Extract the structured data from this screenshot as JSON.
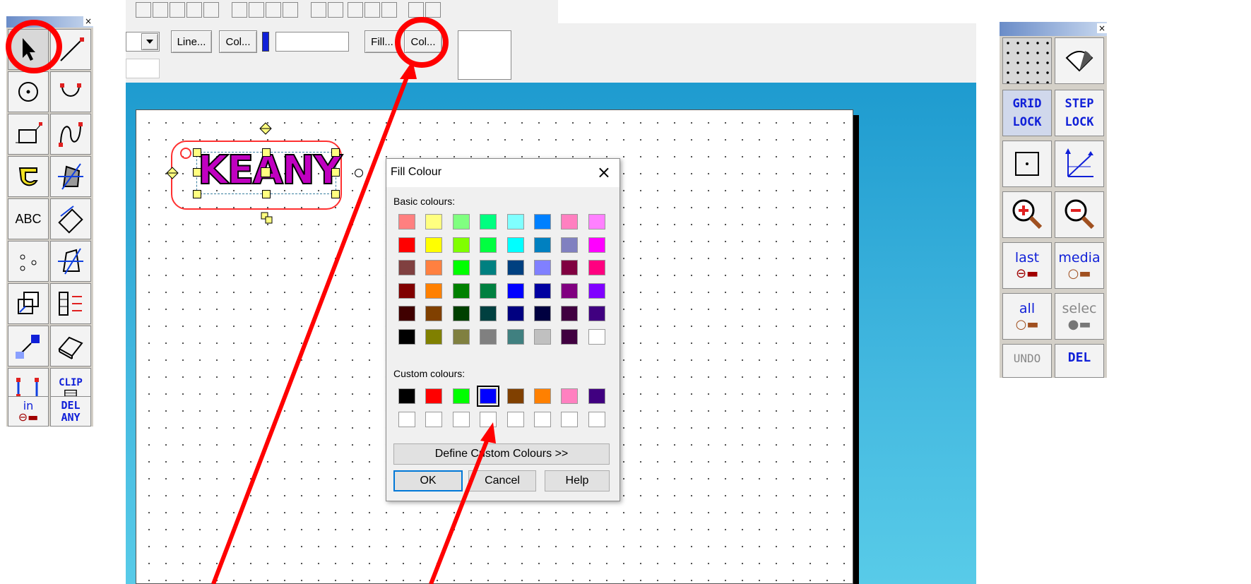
{
  "toolbar": {
    "line_button": "Line...",
    "col_button_1": "Col...",
    "line_colour": "#1020d8",
    "fill_button": "Fill...",
    "col_button_2": "Col..."
  },
  "canvas": {
    "text_object": "KEANY"
  },
  "left_tools": {
    "abc": "ABC",
    "clip": "CLIP",
    "in": "in",
    "del": "DEL",
    "any": "ANY"
  },
  "right_tools": {
    "grid": "GRID",
    "grid_lock": "LOCK",
    "step": "STEP",
    "step_lock": "LOCK",
    "last": "last",
    "media": "media",
    "all": "all",
    "selec": "selec",
    "undo": "UNDO",
    "del": "DEL"
  },
  "dialog": {
    "title": "Fill Colour",
    "basic_label": "Basic colours:",
    "custom_label": "Custom colours:",
    "define_button": "Define Custom Colours >>",
    "ok": "OK",
    "cancel": "Cancel",
    "help": "Help",
    "basic_colours": [
      "#ff8080",
      "#ffff80",
      "#80ff80",
      "#00ff80",
      "#80ffff",
      "#0080ff",
      "#ff80c0",
      "#ff80ff",
      "#ff0000",
      "#ffff00",
      "#80ff00",
      "#00ff40",
      "#00ffff",
      "#0080c0",
      "#8080c0",
      "#ff00ff",
      "#804040",
      "#ff8040",
      "#00ff00",
      "#008080",
      "#004080",
      "#8080ff",
      "#800040",
      "#ff0080",
      "#800000",
      "#ff8000",
      "#008000",
      "#008040",
      "#0000ff",
      "#0000a0",
      "#800080",
      "#8000ff",
      "#400000",
      "#804000",
      "#004000",
      "#004040",
      "#000080",
      "#000040",
      "#400040",
      "#400080",
      "#000000",
      "#808000",
      "#808040",
      "#808080",
      "#408080",
      "#c0c0c0",
      "#400040",
      "#ffffff"
    ],
    "custom_colours": [
      "#000000",
      "#ff0000",
      "#00ff00",
      "#0000ff",
      "#804000",
      "#ff8000",
      "#ff80c0",
      "#400080",
      "#ffffff",
      "#ffffff",
      "#ffffff",
      "#ffffff",
      "#ffffff",
      "#ffffff",
      "#ffffff",
      "#ffffff"
    ],
    "selected_custom_index": 3
  },
  "annotation_colour": "#ff0000"
}
